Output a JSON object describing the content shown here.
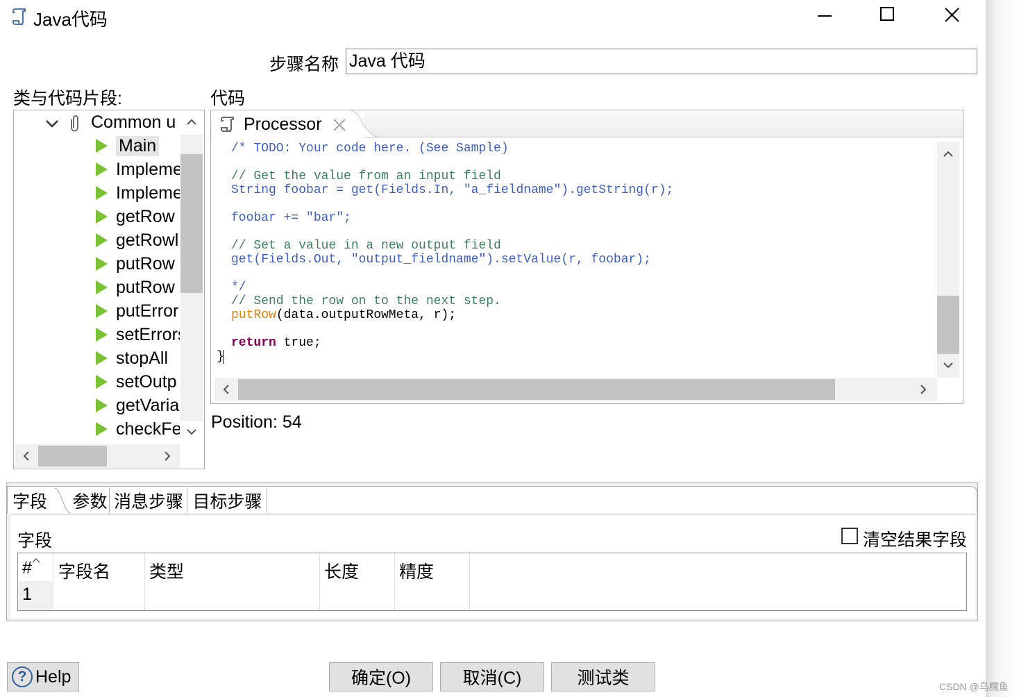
{
  "window": {
    "title": "Java代码",
    "minimize": "─",
    "maximize": "☐",
    "close": "✕"
  },
  "step_name": {
    "label": "步骤名称",
    "value": "Java 代码"
  },
  "classes_label": "类与代码片段:",
  "code_label": "代码",
  "tree": {
    "root": "Common u",
    "items": [
      "Main",
      "Impleme",
      "Impleme",
      "getRow",
      "getRowl",
      "putRow",
      "putRow",
      "putError",
      "setErrors",
      "stopAll",
      "setOutp",
      "getVaria",
      "checkFe"
    ]
  },
  "editor": {
    "tab_label": "Processor",
    "lines": [
      "/* TODO: Your code here. (See Sample)",
      "// Get the value from an input field",
      "String foobar = get(Fields.In, \"a_fieldname\").getString(r);",
      "foobar += \"bar\";",
      "// Set a value in a new output field",
      "get(Fields.Out, \"output_fieldname\").setValue(r, foobar);",
      "*/",
      "// Send the row on to the next step.",
      "putRow",
      "(data.outputRowMeta, r);",
      "return",
      " true;",
      "}"
    ]
  },
  "position_text": "Position: 54",
  "bottom_tabs": [
    "字段",
    "参数",
    "消息步骤",
    "目标步骤"
  ],
  "fields": {
    "section_label": "字段",
    "clear_checkbox_label": "清空结果字段",
    "columns": [
      "#",
      "字段名",
      "类型",
      "长度",
      "精度"
    ],
    "rows": [
      [
        "1",
        "",
        "",
        "",
        ""
      ]
    ]
  },
  "buttons": {
    "help": "Help",
    "ok": "确定(O)",
    "cancel": "取消(C)",
    "test": "测试类"
  },
  "watermark": "CSDN @乌糯鱼"
}
